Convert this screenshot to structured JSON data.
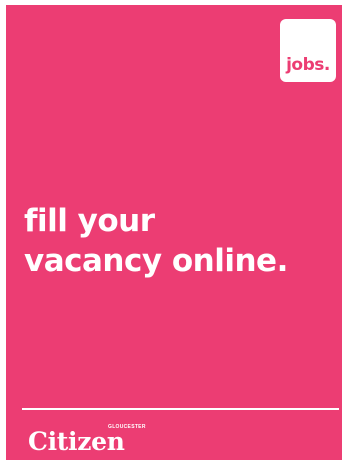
{
  "badge": {
    "label": "jobs."
  },
  "headline": {
    "line1": "fill your",
    "line2": "vacancy online."
  },
  "brand": {
    "sub": "GLOUCESTER",
    "name": "Citizen"
  },
  "colors": {
    "background": "#ec3d73",
    "text": "#ffffff",
    "badge_background": "#ffffff",
    "badge_text": "#ec3d73"
  }
}
